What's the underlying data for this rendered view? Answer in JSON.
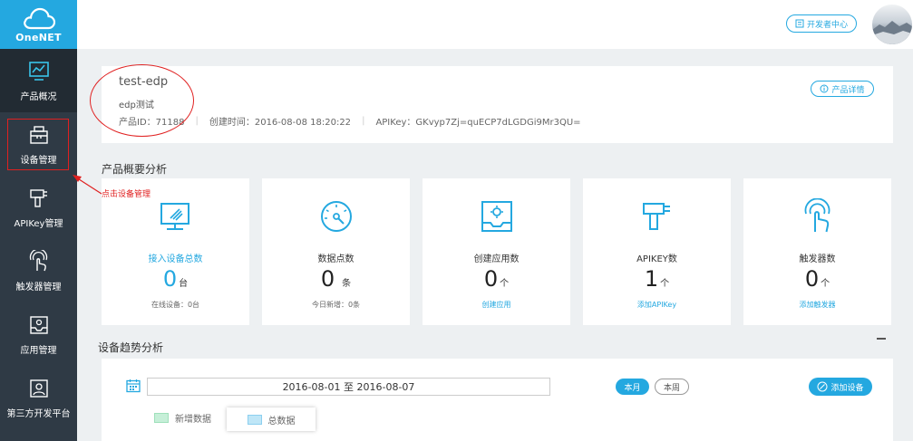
{
  "logo": {
    "text": "OneNET"
  },
  "sidebar": {
    "items": [
      {
        "label": "产品概况"
      },
      {
        "label": "设备管理"
      },
      {
        "label": "APIKey管理"
      },
      {
        "label": "触发器管理"
      },
      {
        "label": "应用管理"
      },
      {
        "label": "第三方开发平台"
      }
    ]
  },
  "header": {
    "dev_center_label": "开发者中心"
  },
  "product": {
    "name": "test-edp",
    "desc": "edp测试",
    "id_text": "产品ID：71188",
    "created_text": "创建时间：2016-08-08 18:20:22",
    "apikey_text": "APIKey：GKvyp7Zj=quECP7dLGDGi9Mr3QU=",
    "detail_label": "产品详情"
  },
  "overview": {
    "title": "产品概要分析"
  },
  "stats": [
    {
      "label": "接入设备总数",
      "value": "0",
      "unit": "台",
      "sub": "在线设备：0台"
    },
    {
      "label": "数据点数",
      "value": "0",
      "unit": "条",
      "sub": "今日新增：0条"
    },
    {
      "label": "创建应用数",
      "value": "0",
      "unit": "个",
      "sub": "创建应用"
    },
    {
      "label": "APIKEY数",
      "value": "1",
      "unit": "个",
      "sub": "添加APIKey"
    },
    {
      "label": "触发器数",
      "value": "0",
      "unit": "个",
      "sub": "添加触发器"
    }
  ],
  "annotation": {
    "text": "点击设备管理"
  },
  "trend": {
    "title": "设备趋势分析",
    "date_range": "2016-08-01 至 2016-08-07",
    "month_label": "本月",
    "week_label": "本周",
    "add_device_label": "添加设备",
    "legend_new": "新增数据",
    "legend_total": "总数据"
  },
  "colors": {
    "accent": "#24a8e0",
    "sidebar": "#2f3a45",
    "annotation": "#e02020"
  }
}
